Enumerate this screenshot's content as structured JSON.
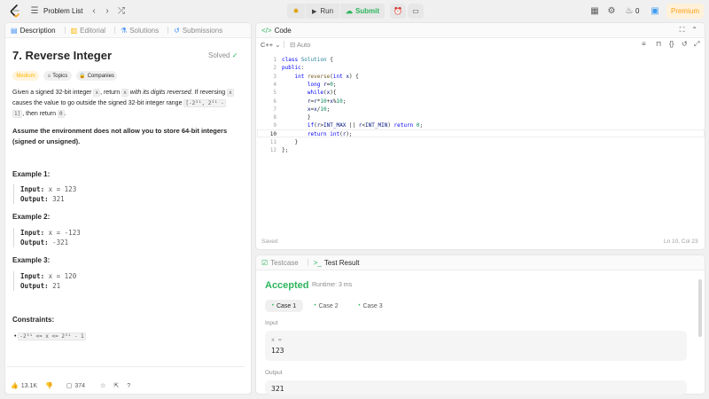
{
  "topbar": {
    "problem_list": "Problem List",
    "run": "Run",
    "submit": "Submit",
    "streak": "0",
    "premium": "Premium"
  },
  "description": {
    "tabs": [
      "Description",
      "Editorial",
      "Solutions",
      "Submissions"
    ],
    "title": "7. Reverse Integer",
    "solved": "Solved",
    "difficulty": "Medium",
    "chips": [
      "Topics",
      "Companies"
    ],
    "para1_a": "Given a signed 32-bit integer",
    "para1_x": "x",
    "para1_b": ", return",
    "para1_x2": "x",
    "para1_c": "with its digits reversed",
    "para1_d": ". If reversing",
    "para1_x3": "x",
    "para2_a": "causes the value to go outside the signed 32-bit integer range",
    "para2_range": "[-2³¹, 2³¹ -",
    "para3_range": "1]",
    "para3_b": ", then return",
    "para3_zero": "0",
    "assume_line1": "Assume the environment does not allow you to store 64-bit integers",
    "assume_line2": "(signed or unsigned).",
    "examples": [
      {
        "title": "Example 1:",
        "input_label": "Input:",
        "input": "x = 123",
        "output_label": "Output:",
        "output": "321"
      },
      {
        "title": "Example 2:",
        "input_label": "Input:",
        "input": "x = -123",
        "output_label": "Output:",
        "output": "-321"
      },
      {
        "title": "Example 3:",
        "input_label": "Input:",
        "input": "x = 120",
        "output_label": "Output:",
        "output": "21"
      }
    ],
    "constraints_title": "Constraints:",
    "constraint": "-2³¹ <= x <= 2³¹ - 1",
    "likes": "13.1K",
    "comments": "374"
  },
  "code": {
    "tab": "Code",
    "language": "C++",
    "auto": "Auto",
    "saved": "Saved",
    "cursor": "Ln 10, Col 23",
    "line_numbers": [
      "1",
      "2",
      "3",
      "4",
      "5",
      "6",
      "7",
      "8",
      "9",
      "10",
      "11",
      "12"
    ]
  },
  "testcase": {
    "tabs": [
      "Testcase",
      "Test Result"
    ],
    "status": "Accepted",
    "runtime": "Runtime: 3 ms",
    "cases": [
      "Case 1",
      "Case 2",
      "Case 3"
    ],
    "input_label": "Input",
    "input_var": "x =",
    "input_value": "123",
    "output_label": "Output",
    "output_value": "321"
  },
  "colors": {
    "accent_orange": "#ffa116",
    "accepted_green": "#2db55d",
    "submit_green": "#2db55d"
  }
}
